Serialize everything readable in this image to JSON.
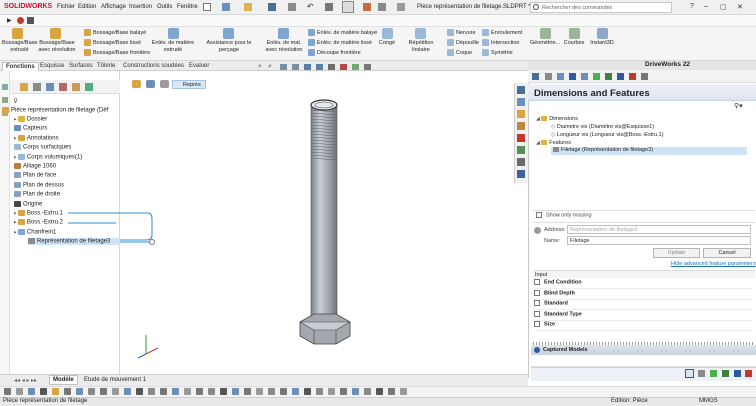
{
  "app": {
    "logo": "SOLIDWORKS",
    "menu": [
      "Fichier",
      "Edition",
      "Affichage",
      "Insertion",
      "Outils",
      "Fenêtre"
    ],
    "document_title": "Pièce représentation de filetage.SLDPRT *",
    "search_placeholder": "Rechercher des commandes"
  },
  "commands": {
    "large": [
      {
        "label": "Bossage/Base\nextrudé",
        "color": "#d9a441"
      },
      {
        "label": "Bossage/Base\navec révolution",
        "color": "#d9a441"
      },
      {
        "label": "Enlèv. de matière\nextrudé",
        "color": "#7fa6d1"
      },
      {
        "label": "Assistance pour le perçage",
        "color": "#7fa6d1"
      },
      {
        "label": "Enlèv. de mat.\navec révolution",
        "color": "#7fa6d1"
      },
      {
        "label": "Congé",
        "color": "#9bb8d8"
      },
      {
        "label": "Répétition linéaire",
        "color": "#9bb8d8"
      },
      {
        "label": "Géométrie...",
        "color": "#9ab59a"
      },
      {
        "label": "Courbes",
        "color": "#9ab59a"
      },
      {
        "label": "Instant3D",
        "color": "#8fa6c7"
      }
    ],
    "small_col1": [
      "Bossage/Base balayé",
      "Bossage/Base lissé",
      "Bossage/Base frontière"
    ],
    "small_col2": [
      "Enlèv. de matière balayé",
      "Enlèv. de matière lissé",
      "Découpe frontière"
    ],
    "small_col3": [
      "Nervure",
      "Dépouille",
      "Coque"
    ],
    "small_col4": [
      "Enroulement",
      "Intersection",
      "Symétrie"
    ]
  },
  "tabs": [
    "Fonctions",
    "Esquisse",
    "Surfaces",
    "Tôlerie",
    "Constructions soudées",
    "Evaluer"
  ],
  "feature_tree": {
    "root": "Pièce représentation de filetage (Déf",
    "items": [
      {
        "label": "Dossier",
        "caret": "▸"
      },
      {
        "label": "Capteurs",
        "caret": ""
      },
      {
        "label": "Annotations",
        "caret": "▸"
      },
      {
        "label": "Corps surfaciques",
        "caret": ""
      },
      {
        "label": "Corps volumiques(1)",
        "caret": "▸"
      },
      {
        "label": "Alliage 1060",
        "caret": ""
      },
      {
        "label": "Plan de face",
        "caret": ""
      },
      {
        "label": "Plan de dessus",
        "caret": ""
      },
      {
        "label": "Plan de droite",
        "caret": ""
      },
      {
        "label": "Origine",
        "caret": ""
      },
      {
        "label": "Boss.-Extru.1",
        "caret": "▸"
      },
      {
        "label": "Boss.-Extru.2",
        "caret": "▸"
      },
      {
        "label": "Chanfrein1",
        "caret": "▸"
      },
      {
        "label": "Représentation de filetage3",
        "caret": ""
      }
    ]
  },
  "viewport": {
    "breadcrumb_label": "Représ"
  },
  "driveworks": {
    "header": "DriveWorks 22",
    "panel_title": "Dimensions and Features",
    "dimensions_label": "Dimensions",
    "dimensions": [
      "Diametre vis (Diamètre vis@Esquisse1)",
      "Longueur vis (Longueur vis@Boss.-Extru.1)"
    ],
    "features_label": "Features",
    "features": [
      "Filetage (Représentation de filetage3)"
    ],
    "show_only_missing": "Show only missing",
    "address_label": "Address:",
    "address_value": "Représentation de filetage3",
    "name_label": "Name:",
    "name_value": "Filetage",
    "update_button": "Update",
    "cancel_button": "Cancel",
    "advanced_link": "Hide advanced feature parameters",
    "input_label": "Input",
    "params": [
      "End Condition",
      "Blind Depth",
      "Standard",
      "Standard Type",
      "Size"
    ],
    "captured_models": "Captured Models"
  },
  "bottom_tabs": [
    "Modèle",
    "Etude de mouvement 1"
  ],
  "status": {
    "left": "Pièce représentation de filetage",
    "mode": "Edition: Pièce",
    "units": "MMGS"
  },
  "colors": {
    "accent": "#1b6fb8",
    "selection": "#cfe3f7",
    "bolt": "#a9afb6"
  }
}
